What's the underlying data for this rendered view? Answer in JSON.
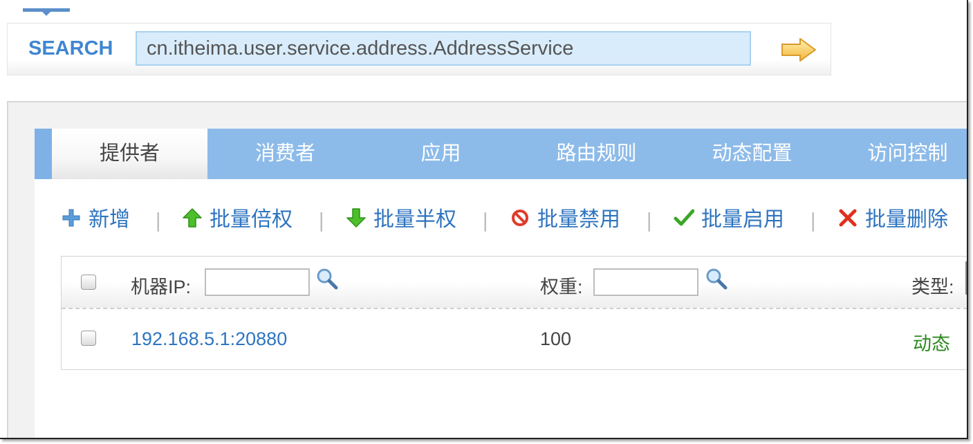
{
  "search": {
    "label": "SEARCH",
    "value": "cn.itheima.user.service.address.AddressService"
  },
  "tabs": [
    {
      "label": "提供者",
      "active": true
    },
    {
      "label": "消费者",
      "active": false
    },
    {
      "label": "应用",
      "active": false
    },
    {
      "label": "路由规则",
      "active": false
    },
    {
      "label": "动态配置",
      "active": false
    },
    {
      "label": "访问控制",
      "active": false
    }
  ],
  "toolbar": {
    "add": "新增",
    "batch_double": "批量倍权",
    "batch_half": "批量半权",
    "batch_disable": "批量禁用",
    "batch_enable": "批量启用",
    "batch_delete": "批量删除",
    "separator": "|"
  },
  "grid": {
    "columns": {
      "ip": "机器IP:",
      "weight": "权重:",
      "type": "类型:"
    },
    "rows": [
      {
        "ip": "192.168.5.1:20880",
        "weight": "100",
        "type": "动态"
      }
    ]
  },
  "colors": {
    "accent": "#2e74c0",
    "tab_bar": "#8dbbe9",
    "type_dynamic": "#2b8a1e",
    "search_label": "#3f86d1"
  },
  "icons": {
    "go": "arrow-right-icon",
    "add": "plus-icon",
    "double": "arrow-up-icon",
    "half": "arrow-down-icon",
    "disable": "forbidden-icon",
    "enable": "checkmark-icon",
    "delete": "x-icon",
    "filter": "magnifier-icon"
  }
}
